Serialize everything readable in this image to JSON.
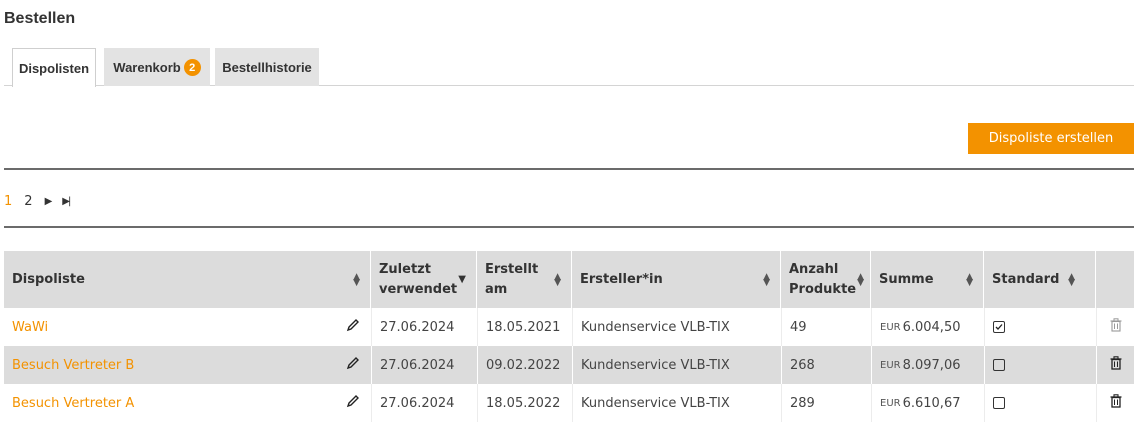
{
  "page": {
    "title": "Bestellen"
  },
  "tabs": [
    {
      "label": "Dispolisten",
      "active": true
    },
    {
      "label": "Warenkorb",
      "badge": "2",
      "active": false
    },
    {
      "label": "Bestellhistorie",
      "active": false
    }
  ],
  "actions": {
    "create_label": "Dispoliste erstellen"
  },
  "pagination": {
    "pages": [
      "1",
      "2"
    ],
    "current": "1",
    "next_icon": "play-icon",
    "last_icon": "skip-to-end-icon"
  },
  "table": {
    "headers": {
      "dispoliste": "Dispoliste",
      "zuletzt_line1": "Zuletzt",
      "zuletzt_line2": "verwendet",
      "erstellt_line1": "Erstellt",
      "erstellt_line2": "am",
      "ersteller": "Ersteller*in",
      "anzahl_line1": "Anzahl",
      "anzahl_line2": "Produkte",
      "summe": "Summe",
      "standard": "Standard"
    },
    "rows": [
      {
        "name": "WaWi",
        "last_used": "27.06.2024",
        "created": "18.05.2021",
        "creator": "Kundenservice VLB-TIX",
        "count": "49",
        "currency": "EUR",
        "sum": "6.004,50",
        "standard": true
      },
      {
        "name": "Besuch Vertreter B",
        "last_used": "27.06.2024",
        "created": "09.02.2022",
        "creator": "Kundenservice VLB-TIX",
        "count": "268",
        "currency": "EUR",
        "sum": "8.097,06",
        "standard": false
      },
      {
        "name": "Besuch Vertreter A",
        "last_used": "27.06.2024",
        "created": "18.05.2022",
        "creator": "Kundenservice VLB-TIX",
        "count": "289",
        "currency": "EUR",
        "sum": "6.610,67",
        "standard": false
      }
    ]
  },
  "colors": {
    "accent": "#f39200",
    "header_bg": "#dcdcdc",
    "rule": "#6b6b6b"
  }
}
